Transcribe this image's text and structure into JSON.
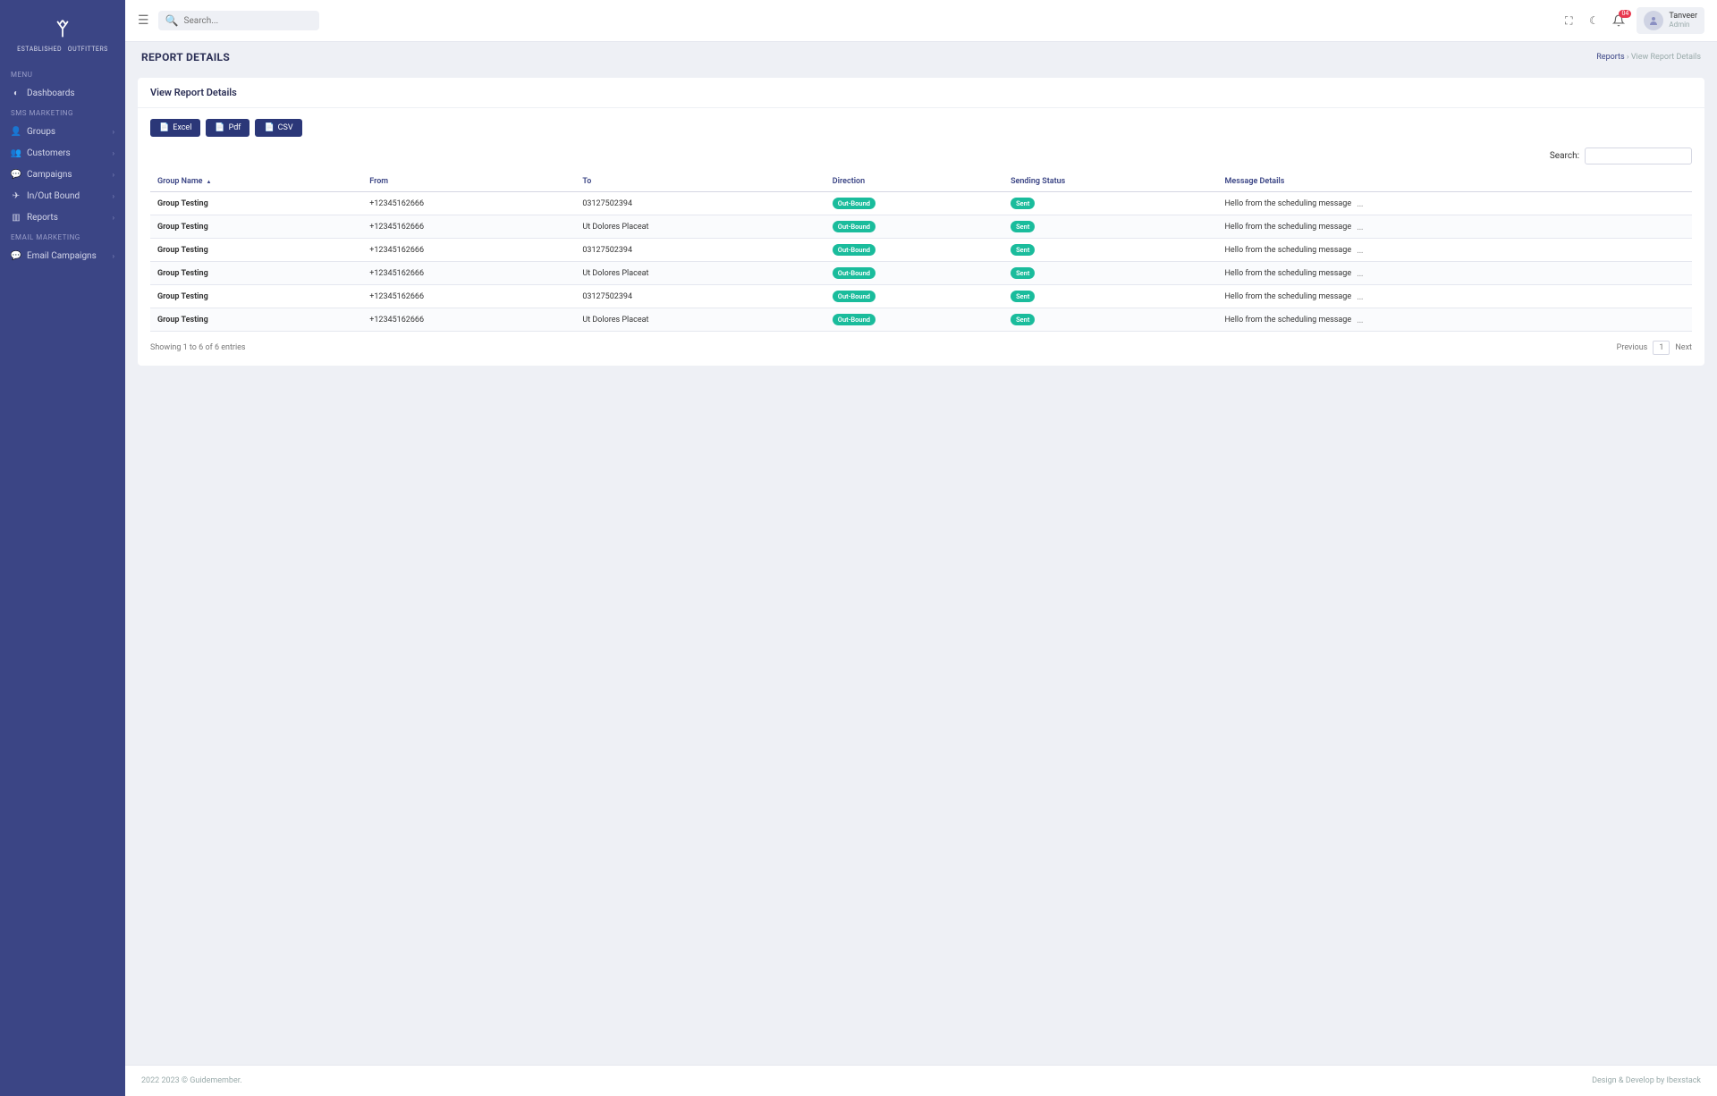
{
  "logo": {
    "line1": "ESTABLISHED",
    "line2": "OUTFITTERS"
  },
  "menu": {
    "header": "MENU",
    "dashboards": "Dashboards",
    "sms_header": "SMS MARKETING",
    "items": [
      {
        "label": "Groups"
      },
      {
        "label": "Customers"
      },
      {
        "label": "Campaigns"
      },
      {
        "label": "In/Out Bound"
      },
      {
        "label": "Reports"
      }
    ],
    "email_header": "EMAIL MARKETING",
    "email_item": "Email Campaigns"
  },
  "topbar": {
    "search_placeholder": "Search...",
    "notif_count": "04",
    "user_name": "Tanveer",
    "user_role": "Admin"
  },
  "page": {
    "title": "REPORT DETAILS",
    "crumb_root": "Reports",
    "crumb_sep": "›",
    "crumb_leaf": "View Report Details",
    "card_title": "View Report Details"
  },
  "buttons": {
    "excel": "Excel",
    "pdf": "Pdf",
    "csv": "CSV"
  },
  "table": {
    "search_label": "Search:",
    "headers": {
      "group": "Group Name",
      "from": "From",
      "to": "To",
      "direction": "Direction",
      "status": "Sending Status",
      "message": "Message Details"
    },
    "rows": [
      {
        "group": "Group Testing",
        "from": "+12345162666",
        "to": "03127502394",
        "direction": "Out-Bound",
        "status": "Sent",
        "message": "Hello from the scheduling message"
      },
      {
        "group": "Group Testing",
        "from": "+12345162666",
        "to": "Ut Dolores Placeat",
        "direction": "Out-Bound",
        "status": "Sent",
        "message": "Hello from the scheduling message"
      },
      {
        "group": "Group Testing",
        "from": "+12345162666",
        "to": "03127502394",
        "direction": "Out-Bound",
        "status": "Sent",
        "message": "Hello from the scheduling message"
      },
      {
        "group": "Group Testing",
        "from": "+12345162666",
        "to": "Ut Dolores Placeat",
        "direction": "Out-Bound",
        "status": "Sent",
        "message": "Hello from the scheduling message"
      },
      {
        "group": "Group Testing",
        "from": "+12345162666",
        "to": "03127502394",
        "direction": "Out-Bound",
        "status": "Sent",
        "message": "Hello from the scheduling message"
      },
      {
        "group": "Group Testing",
        "from": "+12345162666",
        "to": "Ut Dolores Placeat",
        "direction": "Out-Bound",
        "status": "Sent",
        "message": "Hello from the scheduling message"
      }
    ],
    "showing": "Showing 1 to 6 of 6 entries",
    "prev": "Previous",
    "page": "1",
    "next": "Next"
  },
  "footer": {
    "left": "2022 2023 © Guidemember.",
    "right": "Design & Develop by Ibexstack"
  }
}
